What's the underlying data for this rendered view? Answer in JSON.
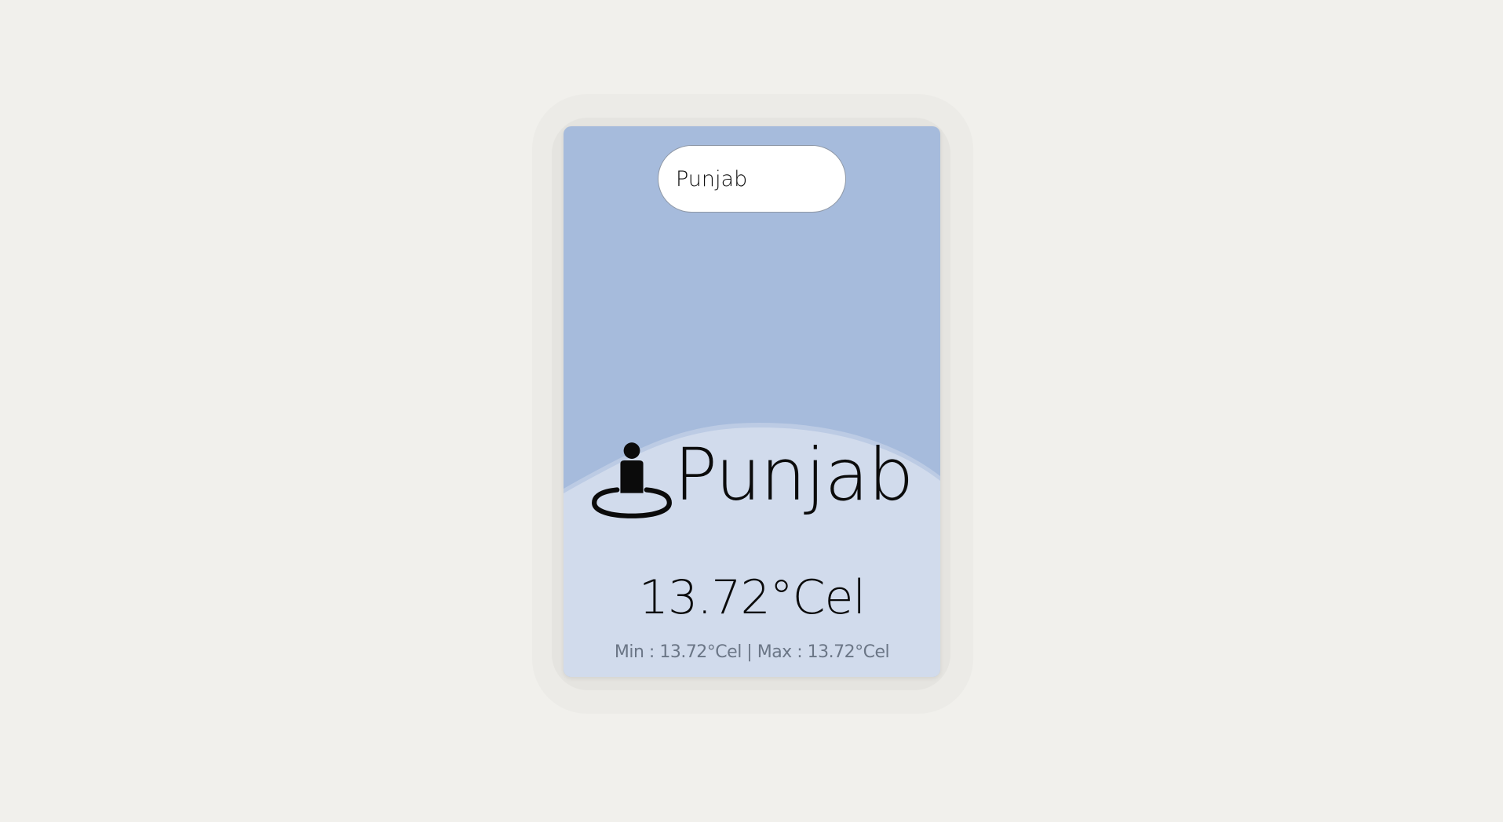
{
  "search": {
    "value": "Punjab"
  },
  "weather": {
    "city": "Punjab",
    "temperature": "13.72°Cel",
    "min_label": "Min",
    "min_value": "13.72°Cel",
    "max_label": "Max",
    "max_value": "13.72°Cel",
    "minmax_text": "Min : 13.72°Cel | Max : 13.72°Cel",
    "location_icon": "person-pin-icon"
  },
  "colors": {
    "page_background": "#f1f0ec",
    "card_top": "#a6bbdc",
    "card_bottom": "#d1dbec",
    "text_primary": "#0b0b0b",
    "text_muted": "#6b7686"
  }
}
